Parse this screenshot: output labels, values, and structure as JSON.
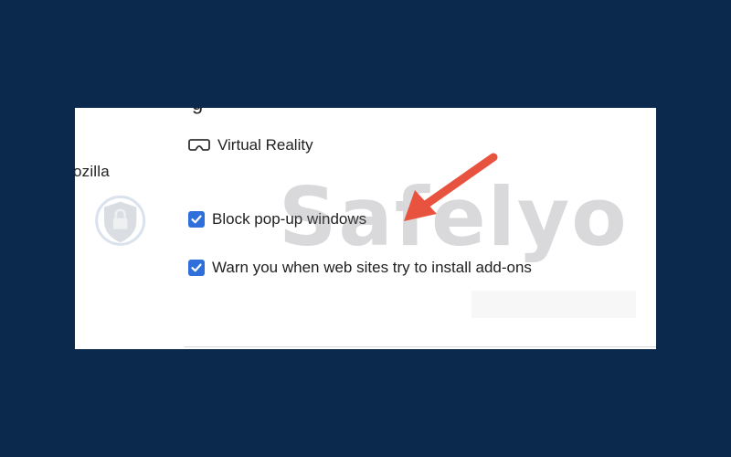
{
  "panel": {
    "side_label": "lozilla",
    "virtual_reality": {
      "label": "Virtual Reality",
      "icon": "vr-headset-icon"
    },
    "block_popups": {
      "label": "Block pop-up windows",
      "checked": true
    },
    "warn_addons": {
      "label": "Warn you when web sites try to install add-ons",
      "checked": true
    }
  },
  "watermark": {
    "text": "Safelyo",
    "icon": "shield-lock-icon"
  },
  "annotation": {
    "icon": "red-arrow-icon",
    "color": "#e8533f"
  },
  "colors": {
    "background": "#0b284d",
    "checkbox": "#2f6fdc"
  }
}
